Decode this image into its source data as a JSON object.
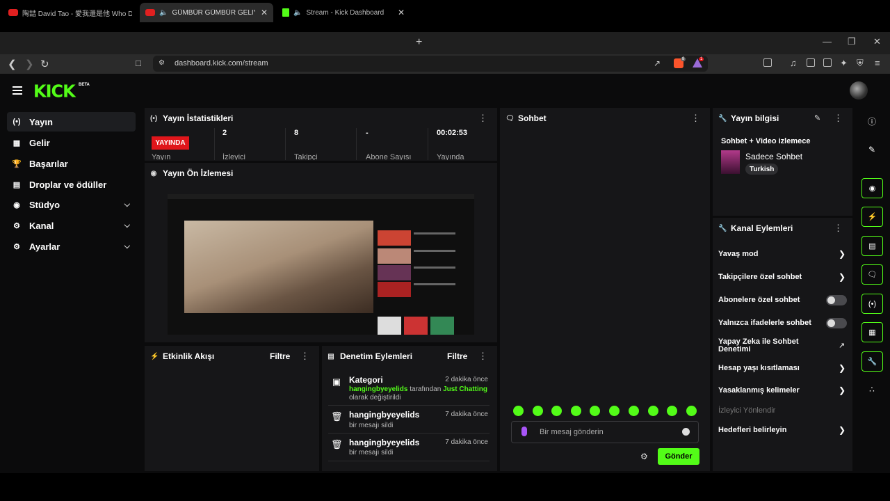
{
  "browser": {
    "tabs": [
      {
        "title": "陶喆 David Tao - 愛我還是他 Who Do",
        "active": false
      },
      {
        "title": "GÜMBÜR GÜMBÜR GELİYORU",
        "active": true
      },
      {
        "title": "Stream - Kick Dashboard",
        "active": false
      }
    ],
    "url": "dashboard.kick.com/stream",
    "brave_badge": "8",
    "rewards_badge": "1"
  },
  "kick": {
    "logo": "KICK",
    "beta": "BETA"
  },
  "sidebar": {
    "items": [
      {
        "label": "Yayın",
        "icon": "broadcast-icon"
      },
      {
        "label": "Gelir",
        "icon": "chart-icon"
      },
      {
        "label": "Başarılar",
        "icon": "trophy-icon"
      },
      {
        "label": "Droplar ve ödüller",
        "icon": "gift-icon"
      },
      {
        "label": "Stüdyo",
        "icon": "studio-icon"
      },
      {
        "label": "Kanal",
        "icon": "channel-icon"
      },
      {
        "label": "Ayarlar",
        "icon": "gear-icon"
      }
    ]
  },
  "stats": {
    "title": "Yayın İstatistikleri",
    "live_badge": "YAYINDA",
    "live_label": "Yayın",
    "viewers_value": "2",
    "viewers_label": "İzleyici",
    "followers_value": "8",
    "followers_label": "Takipçi",
    "subs_value": "-",
    "subs_label": "Abone Sayısı",
    "uptime_value": "00:02:53",
    "uptime_label": "Yayında"
  },
  "preview": {
    "title": "Yayın Ön İzlemesi"
  },
  "activity": {
    "title": "Etkinlik Akışı",
    "filter": "Filtre"
  },
  "moderation": {
    "title": "Denetim Eylemleri",
    "filter": "Filtre",
    "items": [
      {
        "title": "Kategori",
        "time": "2 dakika önce",
        "user": "hangingbyeyelids",
        "mid": " tarafından ",
        "target": "Just Chatting",
        "rest": "olarak değiştirildi"
      },
      {
        "title": "hangingbyeyelids",
        "time": "7 dakika önce",
        "rest": "bir mesajı sildi"
      },
      {
        "title": "hangingbyeyelids",
        "time": "7 dakika önce",
        "rest": "bir mesajı sildi"
      }
    ]
  },
  "chat": {
    "title": "Sohbet",
    "placeholder": "Bir mesaj gönderin",
    "send": "Gönder"
  },
  "stream_info": {
    "title": "Yayın bilgisi",
    "stream_title": "Sohbet + Video izlemece",
    "category": "Sadece Sohbet",
    "tag": "Turkish"
  },
  "channel_actions": {
    "title": "Kanal Eylemleri",
    "items": [
      {
        "label": "Yavaş mod",
        "control": "chevron"
      },
      {
        "label": "Takipçilere özel sohbet",
        "control": "chevron"
      },
      {
        "label": "Abonelere özel sohbet",
        "control": "toggle"
      },
      {
        "label": "Yalnızca ifadelerle sohbet",
        "control": "toggle"
      },
      {
        "label": "Yapay Zeka ile Sohbet Denetimi",
        "control": "external"
      },
      {
        "label": "Hesap yaşı kısıtlaması",
        "control": "chevron"
      },
      {
        "label": "Yasaklanmış kelimeler",
        "control": "chevron"
      },
      {
        "label": "İzleyici Yönlendir",
        "control": "none"
      },
      {
        "label": "Hedefleri belirleyin",
        "control": "chevron"
      }
    ]
  },
  "colors": {
    "accent": "#53fc18",
    "live": "#e0161b",
    "panel": "#161618",
    "background": "#0b0b0c"
  }
}
